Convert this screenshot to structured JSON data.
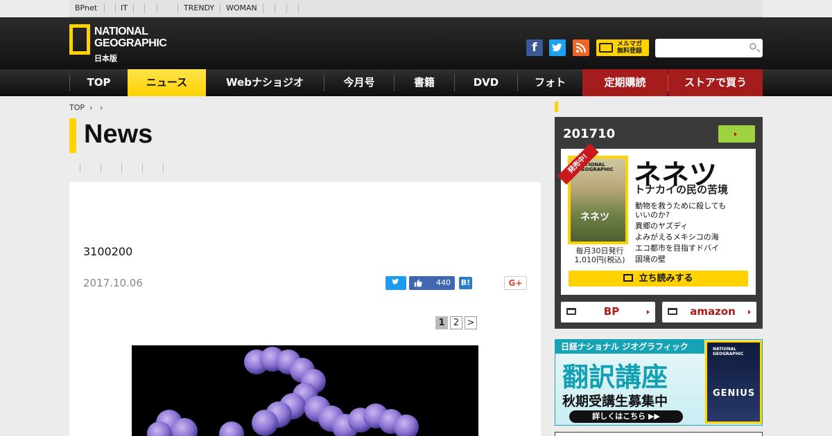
{
  "topbar": {
    "links": [
      "BPnet",
      "IT",
      "TRENDY",
      "WOMAN"
    ]
  },
  "logo": {
    "line1": "NATIONAL",
    "line2": "GEOGRAPHIC",
    "sub": "日本版"
  },
  "header": {
    "mailmag_line1": "メルマガ",
    "mailmag_line2": "無料登録",
    "search_placeholder": ""
  },
  "nav": {
    "items": [
      "TOP",
      "ニュース",
      "Webナショジオ",
      "今月号",
      "書籍",
      "DVD",
      "フォト",
      "定期購読",
      "ストアで買う"
    ]
  },
  "breadcrumb": {
    "top": "TOP"
  },
  "page": {
    "title": "News"
  },
  "article": {
    "headline": "3100200",
    "date": "2017.10.06",
    "like_count": "440",
    "hatena": "B!",
    "gplus": "G+",
    "pages": [
      "1",
      "2",
      ">"
    ]
  },
  "sidebar": {
    "issue": "201710",
    "ribbon": "発売中!",
    "cover_title": "ネネツ",
    "cover_ng": "NATIONAL GEOGRAPHIC",
    "title": "ネネツ",
    "subtitle": "トナカイの民の苦境",
    "lines": [
      "動物を救うために殺しても",
      "いいのか?",
      "異郷のヤズディ",
      "よみがえるメキシコの海",
      "エコ都市を目指すドバイ",
      "国境の壁"
    ],
    "pub_line1": "毎月30日発行",
    "pub_line2": "1,010円(税込)",
    "read_button": "立ち読みする",
    "buy_bp": "BP",
    "buy_amazon": "amazon"
  },
  "banner": {
    "header": "日経ナショナル ジオグラフィック",
    "big": "翻訳講座",
    "mid": "秋期受講生募集中",
    "pill": "詳しくはこちら ▶▶",
    "cover_ng": "NATIONAL GEOGRAPHIC",
    "cover_word": "GENIUS"
  },
  "colors": {
    "accent": "#ffd200",
    "nav_red": "#a51c1c",
    "facebook": "#3b5998",
    "twitter": "#1da1f2",
    "rss": "#f26522"
  }
}
